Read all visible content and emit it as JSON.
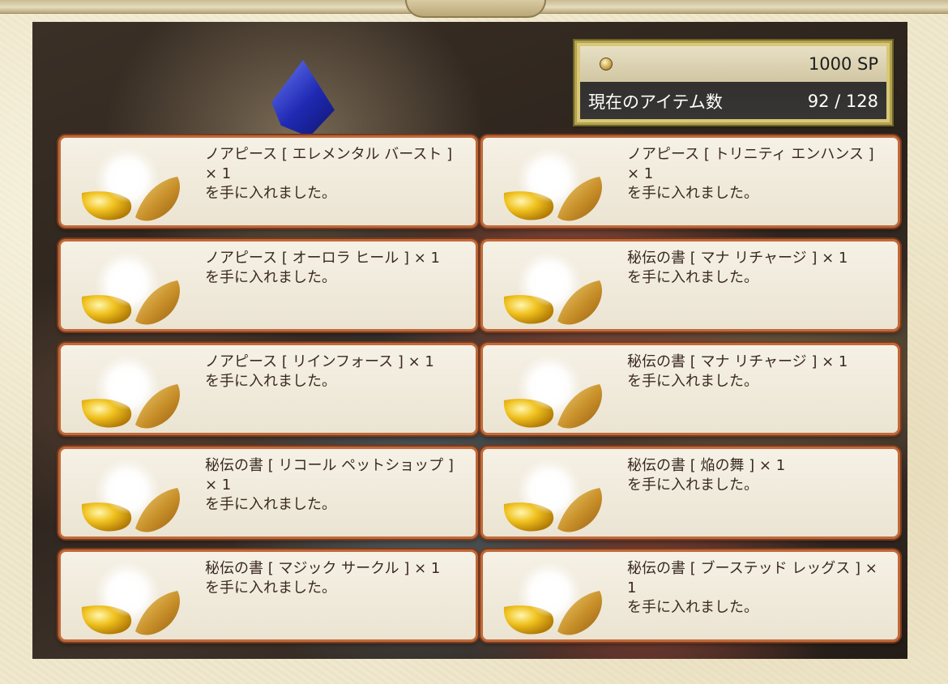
{
  "status": {
    "sp_value": "1000 SP",
    "item_count_label": "現在のアイテム数",
    "item_count_value": "92 / 128"
  },
  "rewards": [
    {
      "name": "ノアピース [ エレメンタル バースト ] × 1",
      "message": "を手に入れました。"
    },
    {
      "name": "ノアピース [ トリニティ エンハンス ] × 1",
      "message": "を手に入れました。"
    },
    {
      "name": "ノアピース [ オーロラ ヒール ] × 1",
      "message": "を手に入れました。"
    },
    {
      "name": "秘伝の書 [ マナ リチャージ ] × 1",
      "message": "を手に入れました。"
    },
    {
      "name": "ノアピース [ リインフォース ] × 1",
      "message": "を手に入れました。"
    },
    {
      "name": "秘伝の書 [ マナ リチャージ ] × 1",
      "message": "を手に入れました。"
    },
    {
      "name": "秘伝の書 [ リコール ペットショップ ] × 1",
      "message": "を手に入れました。"
    },
    {
      "name": "秘伝の書 [ 焔の舞 ] × 1",
      "message": "を手に入れました。"
    },
    {
      "name": "秘伝の書 [ マジック サークル ] × 1",
      "message": "を手に入れました。"
    },
    {
      "name": "秘伝の書 [ ブーステッド レッグス ] × 1",
      "message": "を手に入れました。"
    }
  ],
  "icons": {
    "coin": "sp-coin-icon",
    "reward": "opened-capsule-icon"
  },
  "colors": {
    "card_border": "#c06a3b",
    "panel_border": "#b3a24f",
    "text": "#3a2a1e"
  }
}
